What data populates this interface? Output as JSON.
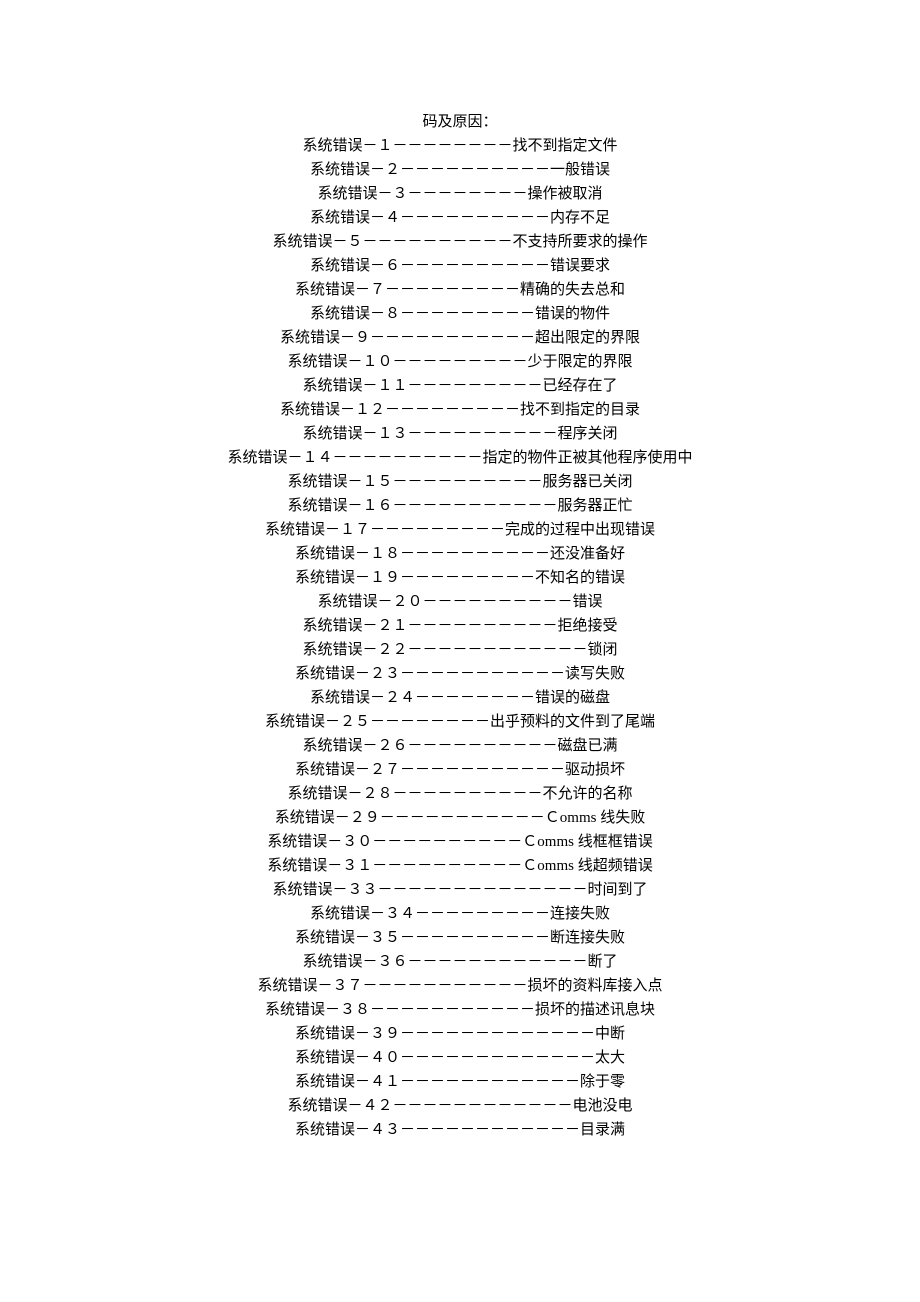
{
  "title": "码及原因：",
  "entries": [
    {
      "code": "１",
      "dash": "－－－－－－－－",
      "desc": "找不到指定文件"
    },
    {
      "code": "２",
      "dash": "－－－－－－－－－－",
      "desc": "一般错误"
    },
    {
      "code": "３",
      "dash": "－－－－－－－－",
      "desc": "操作被取消"
    },
    {
      "code": "４",
      "dash": "－－－－－－－－－－",
      "desc": "内存不足"
    },
    {
      "code": "５",
      "dash": "－－－－－－－－－－",
      "desc": "不支持所要求的操作"
    },
    {
      "code": "６",
      "dash": "－－－－－－－－－－",
      "desc": "错误要求"
    },
    {
      "code": "７",
      "dash": "－－－－－－－－－",
      "desc": "精确的失去总和"
    },
    {
      "code": "８",
      "dash": "－－－－－－－－－",
      "desc": "错误的物件"
    },
    {
      "code": "９",
      "dash": "－－－－－－－－－－－",
      "desc": "超出限定的界限"
    },
    {
      "code": "１０",
      "dash": "－－－－－－－－－",
      "desc": "少于限定的界限"
    },
    {
      "code": "１１",
      "dash": "－－－－－－－－－",
      "desc": "已经存在了"
    },
    {
      "code": "１２",
      "dash": "－－－－－－－－－",
      "desc": "找不到指定的目录"
    },
    {
      "code": "１３",
      "dash": "－－－－－－－－－－",
      "desc": "程序关闭"
    },
    {
      "code": "１４",
      "dash": "－－－－－－－－－－",
      "desc": "指定的物件正被其他程序使用中"
    },
    {
      "code": "１５",
      "dash": "－－－－－－－－－－",
      "desc": "服务器已关闭"
    },
    {
      "code": "１６",
      "dash": "－－－－－－－－－－－",
      "desc": "服务器正忙"
    },
    {
      "code": "１７",
      "dash": "－－－－－－－－－",
      "desc": "完成的过程中出现错误"
    },
    {
      "code": "１８",
      "dash": "－－－－－－－－－－",
      "desc": "还没准备好"
    },
    {
      "code": "１９",
      "dash": "－－－－－－－－－",
      "desc": "不知名的错误"
    },
    {
      "code": "２０",
      "dash": "－－－－－－－－－－",
      "desc": "错误"
    },
    {
      "code": "２１",
      "dash": "－－－－－－－－－－",
      "desc": "拒绝接受"
    },
    {
      "code": "２２",
      "dash": "－－－－－－－－－－－－",
      "desc": "锁闭"
    },
    {
      "code": "２３",
      "dash": "－－－－－－－－－－－",
      "desc": "读写失败"
    },
    {
      "code": "２４",
      "dash": "－－－－－－－－",
      "desc": "错误的磁盘"
    },
    {
      "code": "２５",
      "dash": "－－－－－－－－",
      "desc": "出乎预料的文件到了尾端"
    },
    {
      "code": "２６",
      "dash": "－－－－－－－－－－",
      "desc": "磁盘已满"
    },
    {
      "code": "２７",
      "dash": "－－－－－－－－－－－",
      "desc": "驱动损坏"
    },
    {
      "code": "２８",
      "dash": "－－－－－－－－－－",
      "desc": "不允许的名称"
    },
    {
      "code": "２９",
      "dash": "－－－－－－－－－－－",
      "desc": "Ｃomms 线失败"
    },
    {
      "code": "３０",
      "dash": "－－－－－－－－－－",
      "desc": "Ｃomms 线框框错误"
    },
    {
      "code": "３１",
      "dash": "－－－－－－－－－－",
      "desc": "Ｃomms 线超频错误"
    },
    {
      "code": "３３",
      "dash": "－－－－－－－－－－－－－－",
      "desc": "时间到了"
    },
    {
      "code": "３４",
      "dash": "－－－－－－－－－",
      "desc": "连接失败"
    },
    {
      "code": "３５",
      "dash": "－－－－－－－－－－",
      "desc": "断连接失败"
    },
    {
      "code": "３６",
      "dash": "－－－－－－－－－－－－",
      "desc": "断了"
    },
    {
      "code": "３７",
      "dash": "－－－－－－－－－－－",
      "desc": "损坏的资料库接入点"
    },
    {
      "code": "３８",
      "dash": "－－－－－－－－－－－",
      "desc": "损坏的描述讯息块"
    },
    {
      "code": "３９",
      "dash": "－－－－－－－－－－－－－",
      "desc": "中断"
    },
    {
      "code": "４０",
      "dash": "－－－－－－－－－－－－－",
      "desc": "太大"
    },
    {
      "code": "４１",
      "dash": "－－－－－－－－－－－－",
      "desc": "除于零"
    },
    {
      "code": "４２",
      "dash": "－－－－－－－－－－－－",
      "desc": "电池没电"
    },
    {
      "code": "４３",
      "dash": "－－－－－－－－－－－－",
      "desc": "目录满"
    }
  ],
  "prefix": "系统错误－"
}
